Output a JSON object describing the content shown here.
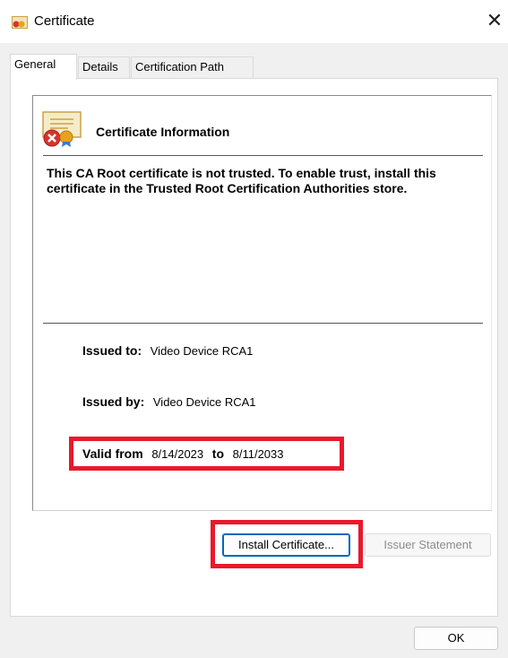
{
  "window": {
    "title": "Certificate",
    "close_glyph": "✕",
    "icon": "certificate-icon"
  },
  "tabs": [
    {
      "label": "General",
      "active": true
    },
    {
      "label": "Details",
      "active": false
    },
    {
      "label": "Certification Path",
      "active": false
    }
  ],
  "info": {
    "icon": "certificate-untrusted-icon",
    "title": "Certificate Information",
    "warning": "This CA Root certificate is not trusted. To enable trust, install this certificate in the Trusted Root Certification Authorities store."
  },
  "fields": {
    "issued_to_label": "Issued to:",
    "issued_to_value": "Video Device RCA1",
    "issued_by_label": "Issued by:",
    "issued_by_value": "Video Device RCA1",
    "valid_from_label": "Valid from",
    "valid_from_value": "8/14/2023",
    "valid_to_label": "to",
    "valid_to_value": "8/11/2033"
  },
  "buttons": {
    "install": "Install Certificate...",
    "issuer": "Issuer Statement",
    "ok": "OK"
  },
  "colors": {
    "highlight": "#e8192c",
    "focus_border": "#0067c0",
    "disabled_text": "#8c8c8c"
  }
}
